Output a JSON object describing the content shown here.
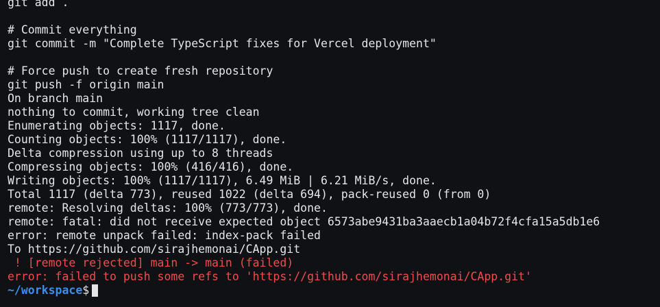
{
  "terminal": {
    "lines": [
      "git add .",
      "",
      "# Commit everything",
      "git commit -m \"Complete TypeScript fixes for Vercel deployment\"",
      "",
      "# Force push to create fresh repository",
      "git push -f origin main",
      "On branch main",
      "nothing to commit, working tree clean",
      "Enumerating objects: 1117, done.",
      "Counting objects: 100% (1117/1117), done.",
      "Delta compression using up to 8 threads",
      "Compressing objects: 100% (416/416), done.",
      "Writing objects: 100% (1117/1117), 6.49 MiB | 6.21 MiB/s, done.",
      "Total 1117 (delta 773), reused 1022 (delta 694), pack-reused 0 (from 0)",
      "remote: Resolving deltas: 100% (773/773), done.",
      "remote: fatal: did not receive expected object 6573abe9431ba3aaecb1a04b72f4cfa15a5db1e6",
      "error: remote unpack failed: index-pack failed",
      "To https://github.com/sirajhemonai/CApp.git"
    ],
    "rejected_line": " ! [remote rejected] main -> main (failed)",
    "error_line": "error: failed to push some refs to 'https://github.com/sirajhemonai/CApp.git'",
    "prompt_path": "~/workspace",
    "prompt_symbol": "$",
    "colors": {
      "background": "#0f1115",
      "text": "#e6e6e6",
      "error": "#f14c4c",
      "prompt": "#3b8eea"
    }
  }
}
